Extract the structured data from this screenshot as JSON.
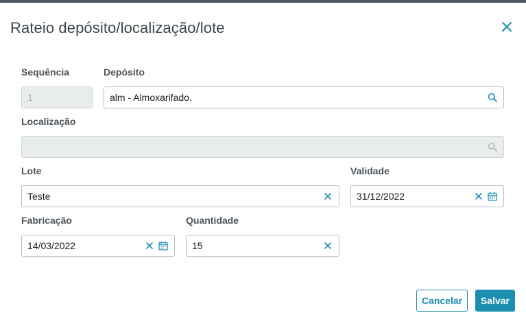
{
  "dialog": {
    "title": "Rateio depósito/localização/lote"
  },
  "form": {
    "sequencia": {
      "label": "Sequência",
      "value": "1"
    },
    "deposito": {
      "label": "Depósito",
      "value": "alm - Almoxarifado."
    },
    "localizacao": {
      "label": "Localização",
      "value": ""
    },
    "lote": {
      "label": "Lote",
      "value": "Teste"
    },
    "validade": {
      "label": "Validade",
      "value": "31/12/2022"
    },
    "fabricacao": {
      "label": "Fabricação",
      "value": "14/03/2022"
    },
    "quantidade": {
      "label": "Quantidade",
      "value": "15"
    }
  },
  "footer": {
    "cancel_label": "Cancelar",
    "save_label": "Salvar"
  },
  "colors": {
    "accent": "#1a8fb0",
    "top_strip": "#4a5862",
    "disabled_bg": "#e9ecec"
  },
  "icons": [
    "close-icon",
    "search-icon",
    "clear-icon",
    "calendar-icon"
  ]
}
